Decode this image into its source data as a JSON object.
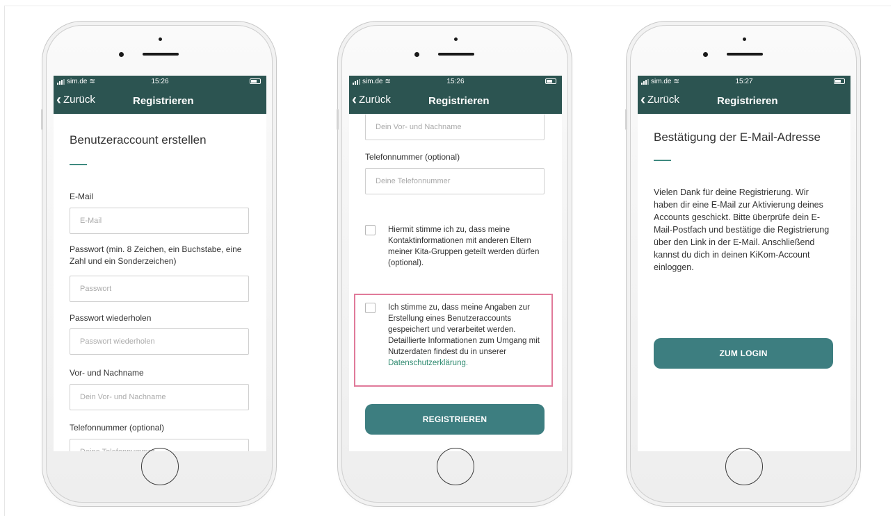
{
  "screens": [
    {
      "status": {
        "carrier": "sim.de",
        "time": "15:26"
      },
      "nav": {
        "back": "Zurück",
        "title": "Registrieren"
      },
      "heading": "Benutzeraccount erstellen",
      "fields": [
        {
          "label": "E-Mail",
          "placeholder": "E-Mail"
        },
        {
          "label": "Passwort (min. 8 Zeichen, ein Buchstabe, eine Zahl und ein Sonderzeichen)",
          "placeholder": "Passwort"
        },
        {
          "label": "Passwort wiederholen",
          "placeholder": "Passwort wiederholen"
        },
        {
          "label": "Vor- und Nachname",
          "placeholder": "Dein Vor- und Nachname"
        },
        {
          "label": "Telefonnummer (optional)",
          "placeholder": "Deine Telefonnummer"
        }
      ]
    },
    {
      "status": {
        "carrier": "sim.de",
        "time": "15:26"
      },
      "nav": {
        "back": "Zurück",
        "title": "Registrieren"
      },
      "name_placeholder": "Dein Vor- und Nachname",
      "phone_label": "Telefonnummer (optional)",
      "phone_placeholder": "Deine Telefonnummer",
      "consent_contact": "Hiermit stimme ich zu, dass meine Kontaktinformationen mit anderen Eltern meiner Kita-Gruppen geteilt werden dürfen (optional).",
      "consent_data": "Ich stimme zu, dass meine Angaben zur Erstellung eines Benutzeraccounts gespeichert und verarbeitet werden. Detaillierte Informationen zum Umgang mit Nutzerdaten findest du in unserer",
      "privacy_link": "Datenschutzerklärung",
      "privacy_period": ".",
      "submit": "REGISTRIEREN"
    },
    {
      "status": {
        "carrier": "sim.de",
        "time": "15:27"
      },
      "nav": {
        "back": "Zurück",
        "title": "Registrieren"
      },
      "heading": "Bestätigung der E-Mail-Adresse",
      "body": "Vielen Dank für deine Registrierung. Wir haben dir eine E-Mail zur Aktivierung deines Accounts geschickt. Bitte überprüfe dein E-Mail-Postfach und bestätige die Registrierung über den Link in der E-Mail. Anschließend kannst du dich in deinen KiKom-Account einloggen.",
      "button": "ZUM LOGIN"
    }
  ],
  "colors": {
    "header": "#2c5451",
    "accent": "#3f8a80",
    "button": "#3d7e80",
    "link": "#2e8a6f",
    "highlight": "#e07a9a"
  },
  "icons": [
    "signal-icon",
    "wifi-icon",
    "battery-icon",
    "back-chevron-icon",
    "home-button"
  ]
}
